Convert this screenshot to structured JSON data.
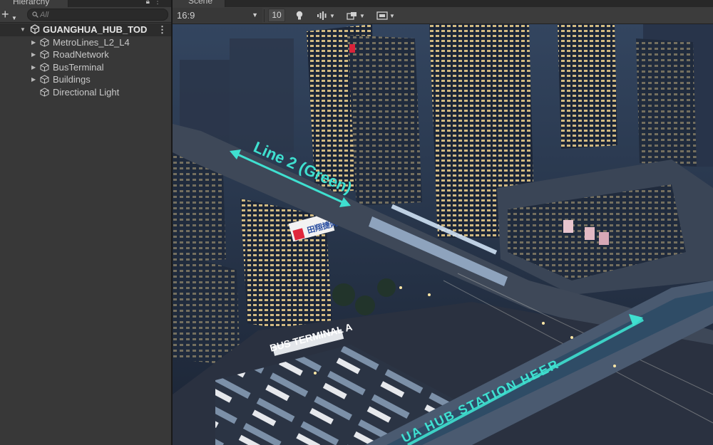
{
  "hierarchy": {
    "tab_label": "Hierarchy",
    "search_placeholder": "All",
    "root": {
      "label": "GUANGHUA_HUB_TOD",
      "icon": "unity-scene-icon"
    },
    "items": [
      {
        "label": "MetroLines_L2_L4",
        "icon": "gameobject-cube-icon",
        "has_children": true
      },
      {
        "label": "RoadNetwork",
        "icon": "gameobject-cube-icon",
        "has_children": true
      },
      {
        "label": "BusTerminal",
        "icon": "gameobject-cube-icon",
        "has_children": true
      },
      {
        "label": "Buildings",
        "icon": "gameobject-cube-icon",
        "has_children": true
      },
      {
        "label": "Directional Light",
        "icon": "gameobject-cube-icon",
        "has_children": false
      }
    ]
  },
  "scene": {
    "tab_label": "Scene",
    "aspect_ratio": "16:9",
    "zoom_value": "10",
    "toolbar_icons": [
      "lighting-bulb-icon",
      "audio-toggle-icon",
      "effects-toggle-icon",
      "gizmos-toggle-icon"
    ],
    "labels": {
      "line2": "Line 2 (Green)",
      "bus_terminal": "BUS TERMINAL A",
      "hub_station": "UA HUB STATION HEER",
      "building_sign": "田翔捷网"
    },
    "colors": {
      "accent_cyan": "#3fe0d0",
      "sky": "#2a3a52",
      "window_light": "#f4d89a"
    }
  }
}
